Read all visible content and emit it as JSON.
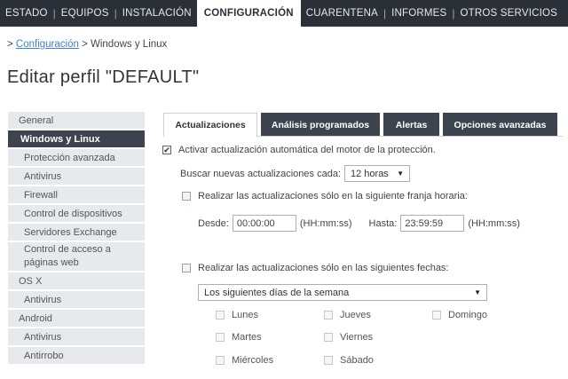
{
  "nav": {
    "items": [
      "ESTADO",
      "EQUIPOS",
      "INSTALACIÓN",
      "CONFIGURACIÓN",
      "CUARENTENA",
      "INFORMES",
      "OTROS SERVICIOS"
    ],
    "active": "CONFIGURACIÓN"
  },
  "breadcrumb": {
    "prefix": ">",
    "link": "Configuración",
    "rest": "> Windows y Linux"
  },
  "page_title": "Editar perfil \"DEFAULT\"",
  "sidebar": {
    "general": "General",
    "windows_linux": "Windows y Linux",
    "proteccion": "Protección avanzada",
    "antivirus": "Antivirus",
    "firewall": "Firewall",
    "control_dispositivos": "Control de dispositivos",
    "servidores_exchange": "Servidores Exchange",
    "control_acceso_1": "Control de acceso a",
    "control_acceso_2": "páginas web",
    "osx": "OS X",
    "osx_antivirus": "Antivirus",
    "android": "Android",
    "android_antivirus": "Antivirus",
    "antirrobo": "Antirrobo"
  },
  "tabs": {
    "actualizaciones": "Actualizaciones",
    "analisis": "Análisis programados",
    "alertas": "Alertas",
    "opciones": "Opciones avanzadas"
  },
  "form": {
    "auto_update_label": "Activar actualización automática del motor de la protección.",
    "auto_update_checked": true,
    "search_label": "Buscar nuevas actualizaciones cada:",
    "search_value": "12 horas",
    "timeslot_label": "Realizar las actualizaciones sólo en la siguiente franja horaria:",
    "timeslot_checked": false,
    "desde_label": "Desde:",
    "desde_value": "00:00:00",
    "desde_hint": "(HH:mm:ss)",
    "hasta_label": "Hasta:",
    "hasta_value": "23:59:59",
    "hasta_hint": "(HH:mm:ss)",
    "dates_label": "Realizar las actualizaciones sólo en las siguientes fechas:",
    "dates_checked": false,
    "dates_select_value": "Los siguientes días de la semana",
    "days": {
      "lunes": "Lunes",
      "martes": "Martes",
      "miercoles": "Miércoles",
      "jueves": "Jueves",
      "viernes": "Viernes",
      "sabado": "Sábado",
      "domingo": "Domingo"
    }
  },
  "glyphs": {
    "check": "✔",
    "caret": "▼"
  }
}
